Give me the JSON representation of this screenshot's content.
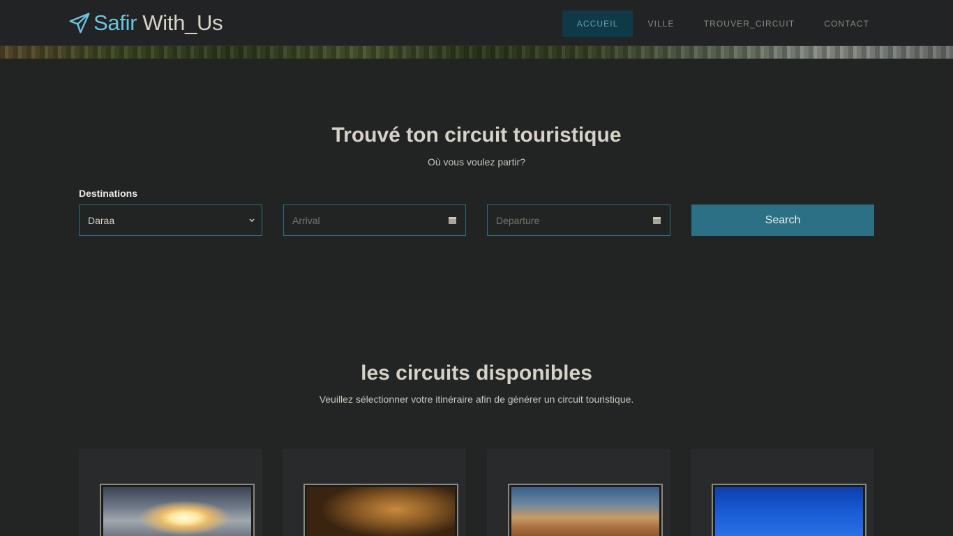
{
  "brand": {
    "part1": "Safir",
    "part2": "With_Us"
  },
  "nav": {
    "items": [
      {
        "label": "ACCUEIL",
        "active": true
      },
      {
        "label": "VILLE",
        "active": false
      },
      {
        "label": "TROUVER_CIRCUIT",
        "active": false
      },
      {
        "label": "CONTACT",
        "active": false
      }
    ]
  },
  "search": {
    "title": "Trouvé ton circuit touristique",
    "subtitle": "Où vous voulez partir?",
    "destinations_label": "Destinations",
    "destination_value": "Daraa",
    "arrival_placeholder": "Arrival",
    "departure_placeholder": "Departure",
    "button_label": "Search"
  },
  "circuits": {
    "title": "les circuits disponibles",
    "subtitle": "Veuillez sélectionner votre itinéraire afin de générer un circuit touristique."
  },
  "colors": {
    "accent": "#2b7084",
    "brand_blue": "#6ec3dd",
    "nav_active_bg": "#0f3947",
    "background": "#232525"
  },
  "icons": [
    "paper-plane-icon",
    "chevron-down-icon",
    "calendar-icon"
  ]
}
